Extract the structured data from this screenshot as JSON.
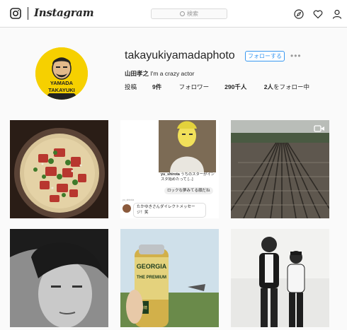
{
  "nav": {
    "wordmark": "Instagram",
    "search_placeholder": "検索"
  },
  "profile": {
    "username": "takayukiyamadaphoto",
    "follow_label": "フォローする",
    "more_label": "•••",
    "full_name": "山田孝之",
    "bio": " I'm a crazy actor",
    "avatar_text_top": "YAMADA",
    "avatar_text_bottom": "TAKAYUKI",
    "stats": {
      "posts_label": "投稿",
      "posts_value": "9件",
      "followers_label": "フォロワー",
      "followers_value": "290千人",
      "following_value": "2人",
      "following_label": "をフォロー中"
    }
  },
  "posts": {
    "screenshot_caption_user": "yu_shirota",
    "screenshot_caption_text": " うちのスターがインスタ始めたって [...]",
    "screenshot_bubble": "ロックな夢みてる顔だね",
    "screenshot_reply_user": "yu_shirota",
    "screenshot_reply": "たかゆきさんダイレクトメッセージ！笑",
    "can_brand_top": "GEORGIA",
    "can_brand_main": "THE PREMIUM",
    "can_label": "微糖",
    "colors": {
      "accent": "#3897f0",
      "avatar_bg": "#f6d000"
    }
  }
}
